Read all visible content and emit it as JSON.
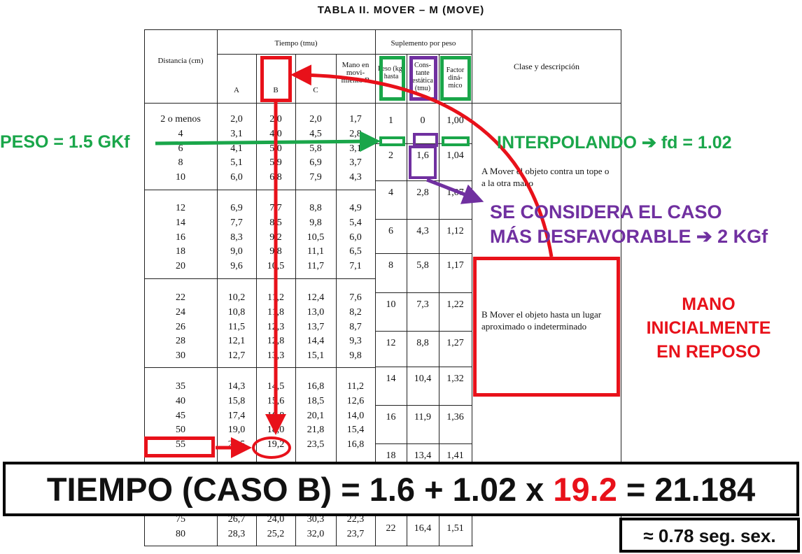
{
  "title": "TABLA II.   MOVER – M (MOVE)",
  "headers": {
    "distancia": "Distancia (cm)",
    "tiempo": "Tiempo (tmu)",
    "col_a": "A",
    "col_b": "B",
    "col_c": "C",
    "mano_mov": "Mano en movi- miento B",
    "suplemento": "Suplemento por peso",
    "peso": "Peso (kg) hasta",
    "constante": "Cons- tante estática (tmu)",
    "factor": "Factor diná- mico",
    "clase": "Clase y descripción"
  },
  "distance_groups": [
    [
      "2 o menos",
      "4",
      "6",
      "8",
      "10"
    ],
    [
      "12",
      "14",
      "16",
      "18",
      "20"
    ],
    [
      "22",
      "24",
      "26",
      "28",
      "30"
    ],
    [
      "35",
      "40",
      "45",
      "50",
      "55"
    ],
    [
      "75",
      "80"
    ]
  ],
  "col_a": [
    [
      "2,0",
      "3,1",
      "4,1",
      "5,1",
      "6,0"
    ],
    [
      "6,9",
      "7,7",
      "8,3",
      "9,0",
      "9,6"
    ],
    [
      "10,2",
      "10,8",
      "11,5",
      "12,1",
      "12,7"
    ],
    [
      "14,3",
      "15,8",
      "17,4",
      "19,0",
      "20,5"
    ],
    [
      "26,7",
      "28,3"
    ]
  ],
  "col_b": [
    [
      "2,0",
      "4,0",
      "5,0",
      "5,9",
      "6,8"
    ],
    [
      "7,7",
      "8,5",
      "9,2",
      "9,8",
      "10,5"
    ],
    [
      "11,2",
      "11,8",
      "12,3",
      "12,8",
      "13,3"
    ],
    [
      "14,5",
      "15,6",
      "16,8",
      "18,0",
      "19,2"
    ],
    [
      "24,0",
      "25,2"
    ]
  ],
  "col_c": [
    [
      "2,0",
      "4,5",
      "5,8",
      "6,9",
      "7,9"
    ],
    [
      "8,8",
      "9,8",
      "10,5",
      "11,1",
      "11,7"
    ],
    [
      "12,4",
      "13,0",
      "13,7",
      "14,4",
      "15,1"
    ],
    [
      "16,8",
      "18,5",
      "20,1",
      "21,8",
      "23,5"
    ],
    [
      "30,3",
      "32,0"
    ]
  ],
  "col_mov": [
    [
      "1,7",
      "2,8",
      "3,1",
      "3,7",
      "4,3"
    ],
    [
      "4,9",
      "5,4",
      "6,0",
      "6,5",
      "7,1"
    ],
    [
      "7,6",
      "8,2",
      "8,7",
      "9,3",
      "9,8"
    ],
    [
      "11,2",
      "12,6",
      "14,0",
      "15,4",
      "16,8"
    ],
    [
      "22,3",
      "23,7"
    ]
  ],
  "weights": [
    {
      "peso": "1",
      "const": "0",
      "factor": "1,00"
    },
    {
      "peso": "2",
      "const": "1,6",
      "factor": "1,04"
    },
    {
      "peso": "4",
      "const": "2,8",
      "factor": "1,07"
    },
    {
      "peso": "6",
      "const": "4,3",
      "factor": "1,12"
    },
    {
      "peso": "8",
      "const": "5,8",
      "factor": "1,17"
    },
    {
      "peso": "10",
      "const": "7,3",
      "factor": "1,22"
    },
    {
      "peso": "12",
      "const": "8,8",
      "factor": "1,27"
    },
    {
      "peso": "14",
      "const": "10,4",
      "factor": "1,32"
    },
    {
      "peso": "16",
      "const": "11,9",
      "factor": "1,36"
    },
    {
      "peso": "18",
      "const": "13,4",
      "factor": "1,41"
    },
    {
      "peso": "22",
      "const": "16,4",
      "factor": "1,51"
    }
  ],
  "class_a": "A  Mover el objeto contra un tope o a la otra mano",
  "class_b": "B  Mover el objeto hasta un lugar aproximado o indeterminado",
  "annotations": {
    "peso": "PESO = 1.5 GKf",
    "interp": "INTERPOLANDO ➔ fd = 1.02",
    "caso1": "SE CONSIDERA EL CASO",
    "caso2": "MÁS DESFAVORABLE ➔ 2 KGf",
    "mano": "MANO INICIALMENTE EN REPOSO",
    "formula_pre": "TIEMPO (CASO B) = 1.6 + 1.02 x ",
    "formula_red": "19.2",
    "formula_post": " = 21.184",
    "seg": "≈ 0.78 seg. sex."
  },
  "colors": {
    "red": "#e8111a",
    "green": "#1aa64a",
    "purple": "#7030a0"
  }
}
